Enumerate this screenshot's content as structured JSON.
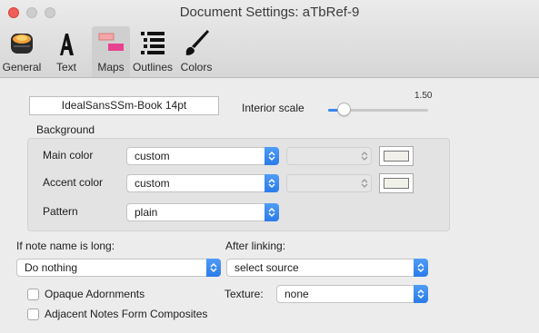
{
  "window": {
    "title": "Document Settings: aTbRef-9"
  },
  "tabs": [
    {
      "label": "General",
      "icon": "general-icon",
      "selected": false
    },
    {
      "label": "Text",
      "icon": "text-icon",
      "selected": false
    },
    {
      "label": "Maps",
      "icon": "maps-icon",
      "selected": true
    },
    {
      "label": "Outlines",
      "icon": "outlines-icon",
      "selected": false
    },
    {
      "label": "Colors",
      "icon": "colors-icon",
      "selected": false
    }
  ],
  "maps": {
    "font_button": "IdealSansSSm-Book 14pt",
    "interior_scale_label": "Interior scale",
    "interior_scale_value": "1.50",
    "interior_scale_fraction": 0.15,
    "background_label": "Background",
    "main_color_label": "Main color",
    "main_color_value": "custom",
    "accent_color_label": "Accent color",
    "accent_color_value": "custom",
    "pattern_label": "Pattern",
    "pattern_value": "plain",
    "long_name_label": "If note name is long:",
    "long_name_value": "Do nothing",
    "after_linking_label": "After linking:",
    "after_linking_value": "select source",
    "opaque_adornments_label": "Opaque Adornments",
    "opaque_adornments_checked": false,
    "adjacent_notes_label": "Adjacent Notes Form Composites",
    "adjacent_notes_checked": false,
    "texture_label": "Texture:",
    "texture_value": "none"
  },
  "colors": {
    "accent": "#3a86f0",
    "close_button": "#ee5f57"
  }
}
